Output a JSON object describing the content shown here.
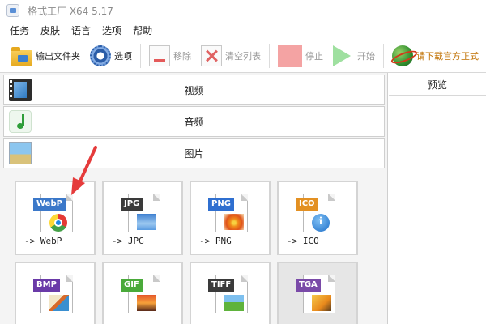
{
  "titlebar": {
    "title": "格式工厂 X64 5.17"
  },
  "menu": [
    "任务",
    "皮肤",
    "语言",
    "选项",
    "帮助"
  ],
  "toolbar": {
    "output_folder": "输出文件夹",
    "options": "选项",
    "remove": "移除",
    "clear_list": "清空列表",
    "stop": "停止",
    "start": "开始",
    "promo": "请下载官方正式"
  },
  "categories": [
    "视频",
    "音频",
    "图片"
  ],
  "tiles": [
    {
      "tag": "WebP",
      "label": "-> WebP",
      "tag_color": "#3b78c9",
      "icon": "chrome-icon"
    },
    {
      "tag": "JPG",
      "label": "-> JPG",
      "tag_color": "#3a3a3a",
      "icon": "landscape-icon"
    },
    {
      "tag": "PNG",
      "label": "-> PNG",
      "tag_color": "#2f6fd0",
      "icon": "flower-icon"
    },
    {
      "tag": "ICO",
      "label": "-> ICO",
      "tag_color": "#e39022",
      "icon": "info-icon"
    },
    {
      "tag": "BMP",
      "tag_color": "#6a3aa8",
      "icon": "paint-icon"
    },
    {
      "tag": "GIF",
      "tag_color": "#4aaa3a",
      "icon": "sunset-icon"
    },
    {
      "tag": "TIFF",
      "tag_color": "#3a3a3a",
      "icon": "meadow-icon"
    },
    {
      "tag": "TGA",
      "tag_color": "#7a4aa8",
      "icon": "image-icon"
    }
  ],
  "preview": {
    "header": "预览"
  },
  "colors": {
    "annotation_arrow": "#e53b3b"
  }
}
